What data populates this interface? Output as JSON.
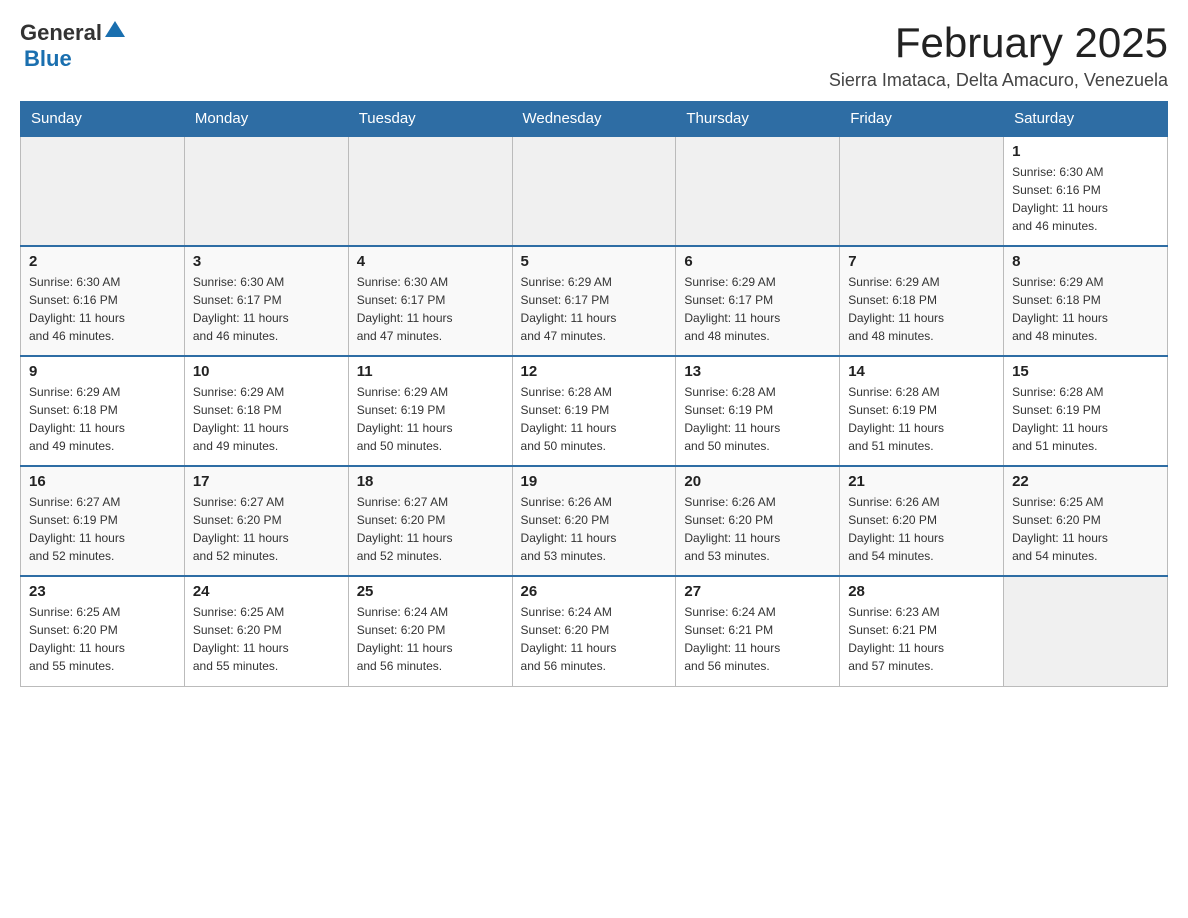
{
  "header": {
    "logo_general": "General",
    "logo_blue": "Blue",
    "title": "February 2025",
    "subtitle": "Sierra Imataca, Delta Amacuro, Venezuela"
  },
  "days_of_week": [
    "Sunday",
    "Monday",
    "Tuesday",
    "Wednesday",
    "Thursday",
    "Friday",
    "Saturday"
  ],
  "weeks": [
    {
      "days": [
        {
          "number": "",
          "info": ""
        },
        {
          "number": "",
          "info": ""
        },
        {
          "number": "",
          "info": ""
        },
        {
          "number": "",
          "info": ""
        },
        {
          "number": "",
          "info": ""
        },
        {
          "number": "",
          "info": ""
        },
        {
          "number": "1",
          "info": "Sunrise: 6:30 AM\nSunset: 6:16 PM\nDaylight: 11 hours\nand 46 minutes."
        }
      ]
    },
    {
      "days": [
        {
          "number": "2",
          "info": "Sunrise: 6:30 AM\nSunset: 6:16 PM\nDaylight: 11 hours\nand 46 minutes."
        },
        {
          "number": "3",
          "info": "Sunrise: 6:30 AM\nSunset: 6:17 PM\nDaylight: 11 hours\nand 46 minutes."
        },
        {
          "number": "4",
          "info": "Sunrise: 6:30 AM\nSunset: 6:17 PM\nDaylight: 11 hours\nand 47 minutes."
        },
        {
          "number": "5",
          "info": "Sunrise: 6:29 AM\nSunset: 6:17 PM\nDaylight: 11 hours\nand 47 minutes."
        },
        {
          "number": "6",
          "info": "Sunrise: 6:29 AM\nSunset: 6:17 PM\nDaylight: 11 hours\nand 48 minutes."
        },
        {
          "number": "7",
          "info": "Sunrise: 6:29 AM\nSunset: 6:18 PM\nDaylight: 11 hours\nand 48 minutes."
        },
        {
          "number": "8",
          "info": "Sunrise: 6:29 AM\nSunset: 6:18 PM\nDaylight: 11 hours\nand 48 minutes."
        }
      ]
    },
    {
      "days": [
        {
          "number": "9",
          "info": "Sunrise: 6:29 AM\nSunset: 6:18 PM\nDaylight: 11 hours\nand 49 minutes."
        },
        {
          "number": "10",
          "info": "Sunrise: 6:29 AM\nSunset: 6:18 PM\nDaylight: 11 hours\nand 49 minutes."
        },
        {
          "number": "11",
          "info": "Sunrise: 6:29 AM\nSunset: 6:19 PM\nDaylight: 11 hours\nand 50 minutes."
        },
        {
          "number": "12",
          "info": "Sunrise: 6:28 AM\nSunset: 6:19 PM\nDaylight: 11 hours\nand 50 minutes."
        },
        {
          "number": "13",
          "info": "Sunrise: 6:28 AM\nSunset: 6:19 PM\nDaylight: 11 hours\nand 50 minutes."
        },
        {
          "number": "14",
          "info": "Sunrise: 6:28 AM\nSunset: 6:19 PM\nDaylight: 11 hours\nand 51 minutes."
        },
        {
          "number": "15",
          "info": "Sunrise: 6:28 AM\nSunset: 6:19 PM\nDaylight: 11 hours\nand 51 minutes."
        }
      ]
    },
    {
      "days": [
        {
          "number": "16",
          "info": "Sunrise: 6:27 AM\nSunset: 6:19 PM\nDaylight: 11 hours\nand 52 minutes."
        },
        {
          "number": "17",
          "info": "Sunrise: 6:27 AM\nSunset: 6:20 PM\nDaylight: 11 hours\nand 52 minutes."
        },
        {
          "number": "18",
          "info": "Sunrise: 6:27 AM\nSunset: 6:20 PM\nDaylight: 11 hours\nand 52 minutes."
        },
        {
          "number": "19",
          "info": "Sunrise: 6:26 AM\nSunset: 6:20 PM\nDaylight: 11 hours\nand 53 minutes."
        },
        {
          "number": "20",
          "info": "Sunrise: 6:26 AM\nSunset: 6:20 PM\nDaylight: 11 hours\nand 53 minutes."
        },
        {
          "number": "21",
          "info": "Sunrise: 6:26 AM\nSunset: 6:20 PM\nDaylight: 11 hours\nand 54 minutes."
        },
        {
          "number": "22",
          "info": "Sunrise: 6:25 AM\nSunset: 6:20 PM\nDaylight: 11 hours\nand 54 minutes."
        }
      ]
    },
    {
      "days": [
        {
          "number": "23",
          "info": "Sunrise: 6:25 AM\nSunset: 6:20 PM\nDaylight: 11 hours\nand 55 minutes."
        },
        {
          "number": "24",
          "info": "Sunrise: 6:25 AM\nSunset: 6:20 PM\nDaylight: 11 hours\nand 55 minutes."
        },
        {
          "number": "25",
          "info": "Sunrise: 6:24 AM\nSunset: 6:20 PM\nDaylight: 11 hours\nand 56 minutes."
        },
        {
          "number": "26",
          "info": "Sunrise: 6:24 AM\nSunset: 6:20 PM\nDaylight: 11 hours\nand 56 minutes."
        },
        {
          "number": "27",
          "info": "Sunrise: 6:24 AM\nSunset: 6:21 PM\nDaylight: 11 hours\nand 56 minutes."
        },
        {
          "number": "28",
          "info": "Sunrise: 6:23 AM\nSunset: 6:21 PM\nDaylight: 11 hours\nand 57 minutes."
        },
        {
          "number": "",
          "info": ""
        }
      ]
    }
  ]
}
